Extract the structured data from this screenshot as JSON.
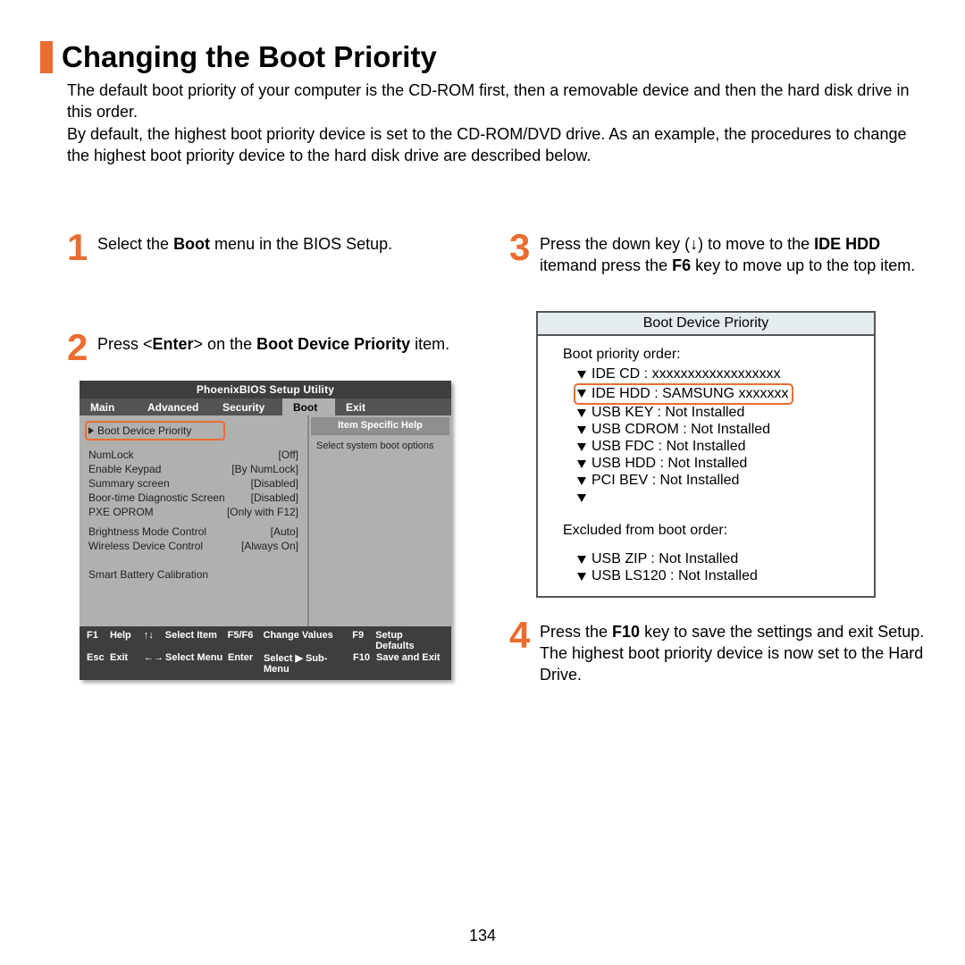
{
  "title": "Changing the Boot Priority",
  "intro1": "The default boot priority of your computer is the CD-ROM first, then a removable device and then the hard disk drive in this order.",
  "intro2": "By default, the highest boot priority device is set to the CD-ROM/DVD drive. As an example, the procedures to change the highest boot priority device to the hard disk drive are described below.",
  "steps": {
    "n1": "1",
    "s1a": "Select the ",
    "s1b": "Boot",
    "s1c": " menu in the BIOS Setup.",
    "n2": "2",
    "s2a": "Press <",
    "s2b": "Enter",
    "s2c": "> on the ",
    "s2d": "Boot Device Priority",
    "s2e": " item.",
    "n3": "3",
    "s3a": "Press the down key (↓) to move to the ",
    "s3b": "IDE HDD",
    "s3c": " itemand press the ",
    "s3d": "F6",
    "s3e": " key to move up to the top item.",
    "n4": "4",
    "s4a": "Press the ",
    "s4b": "F10",
    "s4c": " key to save the settings and exit Setup. The highest boot priority device is now set to the Hard Drive."
  },
  "bios": {
    "utility_title": "PhoenixBIOS Setup Utility",
    "tabs": {
      "main": "Main",
      "advanced": "Advanced",
      "security": "Security",
      "boot": "Boot",
      "exit": "Exit"
    },
    "highlight": "Boot Device Priority",
    "rows": [
      {
        "k": "NumLock",
        "v": "[Off]"
      },
      {
        "k": "Enable Keypad",
        "v": "[By NumLock]"
      },
      {
        "k": "Summary screen",
        "v": "[Disabled]"
      },
      {
        "k": "Boor-time Diagnostic Screen",
        "v": "[Disabled]"
      },
      {
        "k": "PXE OPROM",
        "v": "[Only with F12]"
      }
    ],
    "rows2": [
      {
        "k": "Brightness Mode Control",
        "v": "[Auto]"
      },
      {
        "k": "Wireless Device Control",
        "v": "[Always On]"
      }
    ],
    "rows3": [
      {
        "k": "Smart Battery Calibration",
        "v": ""
      }
    ],
    "help_title": "Item Specific Help",
    "help_text": "Select system boot options",
    "footer": {
      "r1": {
        "k1": "F1",
        "a1": "Help",
        "ar1": "↑↓",
        "a2": "Select Item",
        "k2": "F5/F6",
        "a3": "Change Values",
        "k3": "F9",
        "a4": "Setup Defaults"
      },
      "r2": {
        "k1": "Esc",
        "a1": "Exit",
        "ar1": "←→",
        "a2": "Select Menu",
        "k2": "Enter",
        "a3": "Select ▶ Sub-Menu",
        "k3": "F10",
        "a4": "Save and Exit"
      }
    }
  },
  "bp": {
    "title": "Boot Device Priority",
    "label": "Boot priority order:",
    "items": [
      "IDE CD : xxxxxxxxxxxxxxxxxx",
      "IDE HDD : SAMSUNG xxxxxxx",
      "USB KEY : Not Installed",
      "USB CDROM : Not Installed",
      "USB FDC : Not Installed",
      "USB HDD : Not Installed",
      "PCI BEV : Not Installed"
    ],
    "ex_label": "Excluded from boot order:",
    "ex_items": [
      "USB ZIP : Not Installed",
      "USB LS120 : Not Installed"
    ]
  },
  "page_number": "134"
}
